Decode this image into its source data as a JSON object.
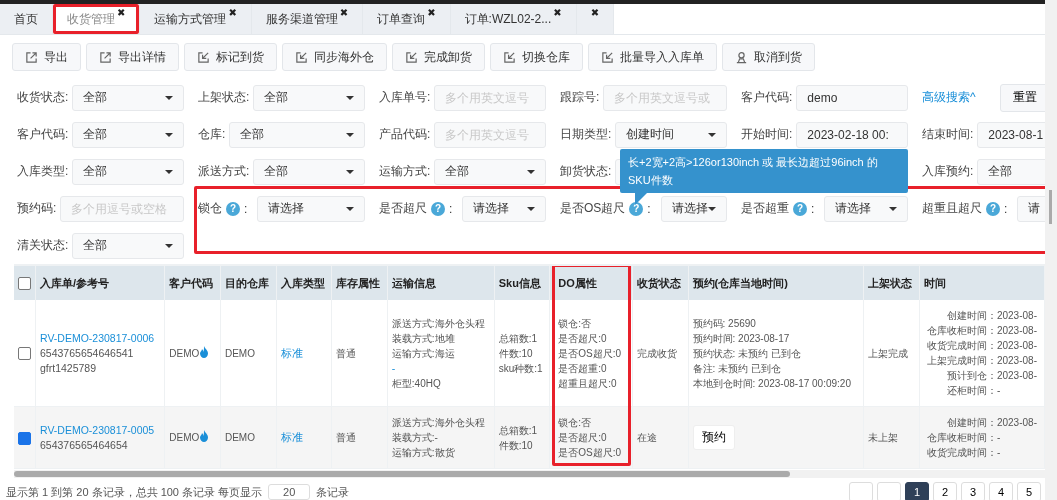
{
  "tabs": [
    {
      "label": "首页",
      "selected": false,
      "highlighted": false
    },
    {
      "label": "收货管理",
      "close": "✖",
      "selected": true,
      "highlighted": true
    },
    {
      "label": "运输方式管理",
      "close": "✖",
      "selected": false,
      "highlighted": false
    },
    {
      "label": "服务渠道管理",
      "close": "✖",
      "selected": false,
      "highlighted": false
    },
    {
      "label": "订单查询",
      "close": "✖",
      "selected": false,
      "highlighted": false
    },
    {
      "label": "订单:WZL02-2...",
      "close": "✖",
      "selected": false,
      "highlighted": false
    },
    {
      "close": "✖",
      "selected": false,
      "highlighted": false
    }
  ],
  "toolbar": [
    {
      "label": "导出",
      "kind": "export"
    },
    {
      "label": "导出详情",
      "kind": "export"
    },
    {
      "label": "标记到货",
      "kind": "import"
    },
    {
      "label": "同步海外仓",
      "kind": "import"
    },
    {
      "label": "完成卸货",
      "kind": "import"
    },
    {
      "label": "切换仓库",
      "kind": "import"
    },
    {
      "label": "批量导入入库单",
      "kind": "import"
    },
    {
      "label": "取消到货",
      "kind": "user"
    }
  ],
  "filters": [
    {
      "items": [
        {
          "kind": "select",
          "label": "收货状态:",
          "value": "全部"
        },
        {
          "kind": "select",
          "label": "上架状态:",
          "value": "全部"
        },
        {
          "kind": "input",
          "label": "入库单号:",
          "placeholder": "多个用英文逗号"
        },
        {
          "kind": "input",
          "label": "跟踪号:",
          "placeholder": "多个用英文逗号或"
        },
        {
          "kind": "input",
          "label": "客户代码:",
          "value": "demo"
        },
        {
          "kind": "actions",
          "link": "高级搜索^",
          "button": "重置"
        }
      ]
    },
    {
      "items": [
        {
          "kind": "select",
          "label": "客户代码:",
          "value": "全部"
        },
        {
          "kind": "select",
          "label": "仓库:",
          "value": "全部"
        },
        {
          "kind": "input",
          "label": "产品代码:",
          "placeholder": "多个用英文逗号"
        },
        {
          "kind": "select",
          "label": "日期类型:",
          "value": "创建时间"
        },
        {
          "kind": "input",
          "label": "开始时间:",
          "value": "2023-02-18 00:"
        },
        {
          "kind": "input",
          "label": "结束时间:",
          "value": "2023-08-1"
        }
      ]
    },
    {
      "items": [
        {
          "kind": "select",
          "label": "入库类型:",
          "value": "全部"
        },
        {
          "kind": "select",
          "label": "派送方式:",
          "value": "全部"
        },
        {
          "kind": "select",
          "label": "运输方式:",
          "value": "全部"
        },
        {
          "kind": "select",
          "label": "卸货状态:",
          "value": ""
        },
        {
          "kind": "tooltip",
          "text": "长+2宽+2高>126or130inch 或 最长边超过96inch 的SKU件数"
        },
        {
          "kind": "select",
          "label": "入库预约:",
          "value": "全部"
        }
      ]
    },
    {
      "items": [
        {
          "kind": "input",
          "label": "预约码:",
          "placeholder": "多个用逗号或空格"
        }
      ],
      "group": {
        "highlighted": true,
        "items": [
          {
            "kind": "select",
            "label": "锁仓",
            "help": "?",
            "colon": ":",
            "value": "请选择"
          },
          {
            "kind": "select",
            "label": "是否超尺",
            "help": "?",
            "colon": ":",
            "value": "请选择"
          },
          {
            "kind": "select",
            "label": "是否OS超尺",
            "help": "?",
            "colon": ":",
            "value": "请选择"
          },
          {
            "kind": "select",
            "label": "是否超重",
            "help": "?",
            "colon": ":",
            "value": "请选择"
          },
          {
            "kind": "select",
            "label": "超重且超尺",
            "help": "?",
            "colon": ":",
            "value": "请"
          }
        ]
      }
    },
    {
      "items": [
        {
          "kind": "select",
          "label": "清关状态:",
          "value": "全部"
        }
      ]
    }
  ],
  "table": {
    "all_selected": false,
    "columns": [
      {
        "label": "入库单/参考号",
        "highlighted": false
      },
      {
        "label": "客户代码",
        "highlighted": false
      },
      {
        "label": "目的仓库",
        "highlighted": false
      },
      {
        "label": "入库类型",
        "highlighted": false
      },
      {
        "label": "库存属性",
        "highlighted": false
      },
      {
        "label": "运输信息",
        "highlighted": false
      },
      {
        "label": "Sku信息",
        "highlighted": false
      },
      {
        "label": "DO属性",
        "highlighted": true
      },
      {
        "label": "收货状态",
        "highlighted": false
      },
      {
        "label": "预约(仓库当地时间)",
        "highlighted": false
      },
      {
        "label": "上架状态",
        "highlighted": false
      },
      {
        "label": "时间",
        "highlighted": false
      }
    ],
    "rows": [
      {
        "selected": false,
        "order": "RV-DEMO-230817-0006",
        "refs": [
          "6543765654646541",
          "gfrt1425789"
        ],
        "customer": "DEMO",
        "warehouse": "DEMO",
        "type": "标准",
        "stock": "普通",
        "transport": [
          {
            "kind": "plain",
            "text": "派送方式:海外仓头程"
          },
          {
            "kind": "plain",
            "text": "装载方式:地堆"
          },
          {
            "kind": "plain",
            "text": "运输方式:海运"
          },
          {
            "kind": "link",
            "text": "-"
          },
          {
            "kind": "plain",
            "text": "柜型:40HQ"
          }
        ],
        "sku": [
          "总箱数:1",
          "件数:10",
          "sku种数:1"
        ],
        "do": [
          "锁仓:否",
          "是否超尺:0",
          "是否OS超尺:0",
          "是否超重:0",
          "超重且超尺:0"
        ],
        "receipt_status": "完成收货",
        "booking": {
          "kind": "lines",
          "lines": [
            "预约码: 25690",
            "预约时间: 2023-08-17",
            "预约状态: 未预约 已到仓",
            "备注: 未预约 已到仓",
            "本地到仓时间: 2023-08-17 00:09:20"
          ]
        },
        "shelf_status": "上架完成",
        "times": [
          {
            "label": "创建时间：",
            "value": "2023-08-"
          },
          {
            "label": "仓库收柜时间：",
            "value": "2023-08-"
          },
          {
            "label": "收货完成时间：",
            "value": "2023-08-"
          },
          {
            "label": "上架完成时间：",
            "value": "2023-08-"
          },
          {
            "label": "预计到仓：",
            "value": "2023-08-"
          },
          {
            "label": "还柜时间：",
            "value": "-"
          }
        ]
      },
      {
        "selected": true,
        "order": "RV-DEMO-230817-0005",
        "refs": [
          "654376565464654"
        ],
        "customer": "DEMO",
        "warehouse": "DEMO",
        "type": "标准",
        "stock": "普通",
        "transport": [
          {
            "kind": "plain",
            "text": "派送方式:海外仓头程"
          },
          {
            "kind": "plain",
            "text": "装载方式:-"
          },
          {
            "kind": "plain",
            "text": "运输方式:散货"
          }
        ],
        "sku": [
          "总箱数:1",
          "件数:10"
        ],
        "do": [
          "锁仓:否",
          "是否超尺:0",
          "是否OS超尺:0"
        ],
        "receipt_status": "在途",
        "booking": {
          "kind": "button",
          "label": "预约"
        },
        "shelf_status": "未上架",
        "times": [
          {
            "label": "创建时间：",
            "value": "2023-08-"
          },
          {
            "label": "仓库收柜时间：",
            "value": "-"
          },
          {
            "label": "收货完成时间：",
            "value": "-"
          }
        ]
      }
    ]
  },
  "footer": {
    "summary": "显示第 1 到第 20 条记录，总共 100 条记录 每页显示",
    "page_size": "20",
    "suffix": "条记录",
    "pages": [
      {
        "selected": false
      },
      {
        "selected": false
      },
      {
        "label": "1",
        "selected": true
      },
      {
        "label": "2",
        "selected": false
      },
      {
        "label": "3",
        "selected": false
      },
      {
        "label": "4",
        "selected": false
      },
      {
        "label": "5",
        "selected": false
      }
    ]
  }
}
